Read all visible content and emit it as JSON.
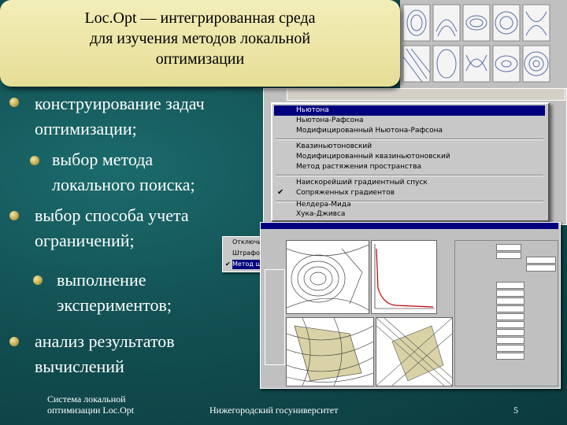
{
  "title": {
    "line1": "Loc.Opt — интегрированная среда",
    "line2": "для изучения методов локальной",
    "line3": "оптимизации"
  },
  "bullets": [
    {
      "l1": "конструирование задач",
      "l2": "оптимизации;"
    },
    {
      "l1": "выбор метода",
      "l2": "локального поиска;"
    },
    {
      "l1": "выбор способа учета",
      "l2": "ограничений;"
    },
    {
      "l1": "выполнение",
      "l2": "экспериментов;"
    },
    {
      "l1": "анализ результатов",
      "l2": "вычислений"
    }
  ],
  "footer": {
    "left_l1": "Система локальной",
    "left_l2": "оптимизации Loc.Opt",
    "center": "Нижегородский госуниверситет",
    "page": "5"
  },
  "method_menu": {
    "items": [
      "Ньютона",
      "Ньютона-Рафсона",
      "Модифицированный Ньютона-Рафсона",
      "Квазиньютоновский",
      "Модифицированный квазиньютоновский",
      "Метод растяжения пространства",
      "Наискорейший градиентный спуск",
      "Сопряженных градиентов",
      "Нелдера-Мида",
      "Хука-Дживса"
    ],
    "selected_index": 0,
    "checked_index": 7
  },
  "context_menu": {
    "items": [
      "Отключить",
      "Штрафовой",
      "Метод штраф"
    ]
  },
  "colors": {
    "background": "#11494c",
    "title_box": "#ede5a6",
    "menu_highlight": "#00007f"
  }
}
